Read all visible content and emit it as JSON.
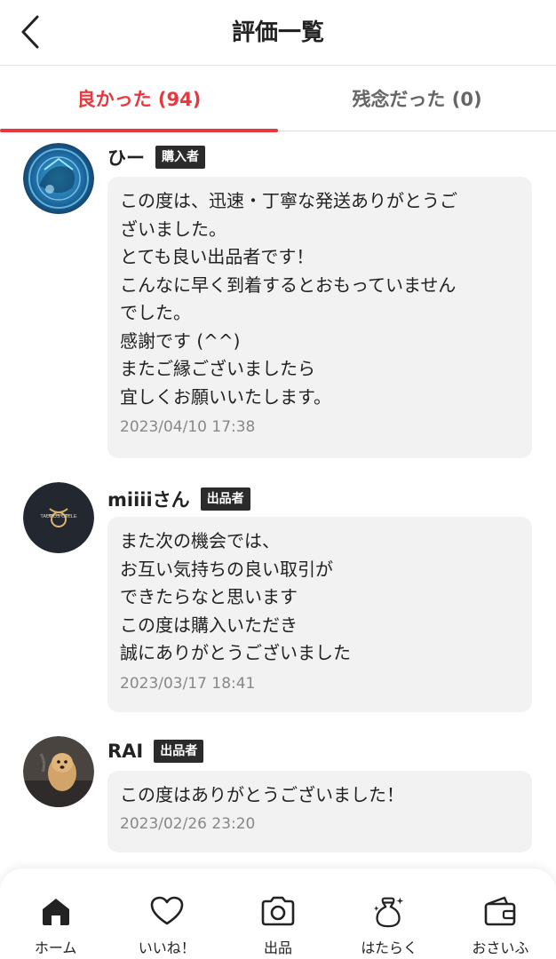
{
  "header": {
    "title": "評価一覧",
    "back_icon": "chevron-left-icon"
  },
  "tabs": [
    {
      "label": "良かった (94)",
      "active": true
    },
    {
      "label": "残念だった (0)",
      "active": false
    }
  ],
  "reviews": [
    {
      "name": "ひー",
      "role": "購入者",
      "comment": "この度は、迅速・丁寧な発送ありがとうご\nざいました。\nとても良い出品者です！\nこんなに早く到着するとおもっていません\nでした。\n感謝です (^^)\nまたご縁ございましたら\n宜しくお願いいたします。",
      "date": "2023/04/10 17:38"
    },
    {
      "name": "miiiiさん",
      "role": "出品者",
      "comment": "また次の機会では、\nお互い気持ちの良い取引が\nできたらなと思います\nこの度は購入いただき\n誠にありがとうございました",
      "date": "2023/03/17 18:41",
      "avatar_text": "TAURUS CELLE"
    },
    {
      "name": "RAI",
      "role": "出品者",
      "comment": "この度はありがとうございました！",
      "date": "2023/02/26 23:20"
    }
  ],
  "bottom_nav": [
    {
      "label": "ホーム",
      "icon": "home-icon",
      "active": true
    },
    {
      "label": "いいね！",
      "icon": "heart-icon",
      "active": false
    },
    {
      "label": "出品",
      "icon": "camera-icon",
      "active": false
    },
    {
      "label": "はたらく",
      "icon": "money-bag-icon",
      "active": false
    },
    {
      "label": "おさいふ",
      "icon": "wallet-icon",
      "active": false
    }
  ],
  "colors": {
    "accent": "#e8383d",
    "badge_bg": "#2b2b2b",
    "bubble_bg": "#f2f2f2"
  }
}
